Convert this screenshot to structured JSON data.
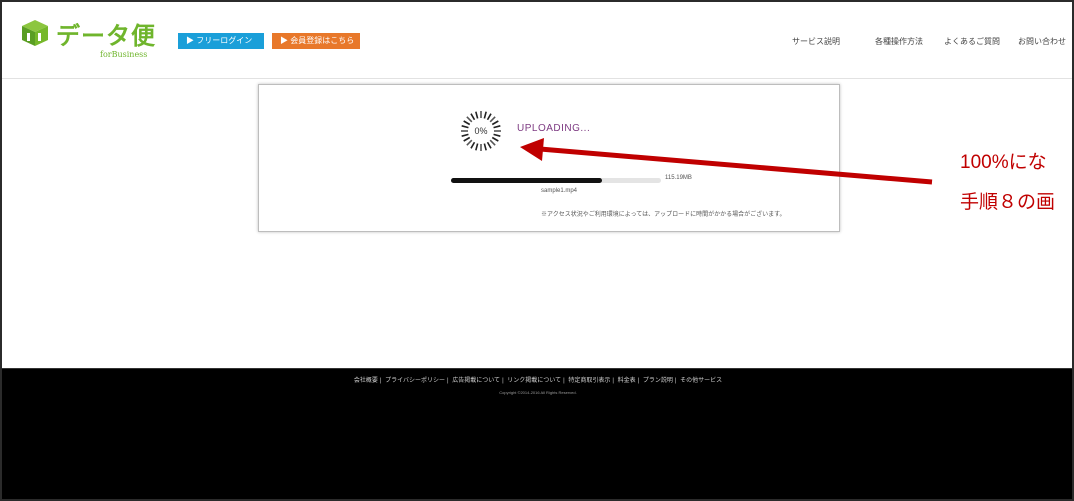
{
  "header": {
    "logo_text": "データ便",
    "logo_sub": "forBusiness",
    "free_login": "▶ フリーログイン",
    "register": "▶ 会員登録はこちら",
    "nav": [
      "サービス説明",
      "各種操作方法",
      "よくあるご質問",
      "お問い合わせ"
    ]
  },
  "upload": {
    "percent": "0%",
    "status": "UPLOADING...",
    "progress_fraction": 0.72,
    "size": "115.19MB",
    "filename": "sample1.mp4",
    "note": "※アクセス状況やご利用環境によっては、アップロードに時間がかかる場合がございます。"
  },
  "annotation": {
    "line1": "100%にな",
    "line2": "手順８の画"
  },
  "footer": {
    "links": [
      "会社概要",
      "プライバシーポリシー",
      "広告掲載について",
      "リンク掲載について",
      "特定商取引表示",
      "料金表",
      "プラン説明",
      "その他サービス"
    ],
    "copyright": "Copyright ©2014-2016 All Rights Reserved."
  },
  "colors": {
    "logo": "#6fb52c",
    "free_login_bg": "#1a9fd9",
    "register_bg": "#e8782a",
    "uploading_text": "#7d3a82",
    "annotation": "#c00000",
    "footer_bg": "#000000"
  }
}
